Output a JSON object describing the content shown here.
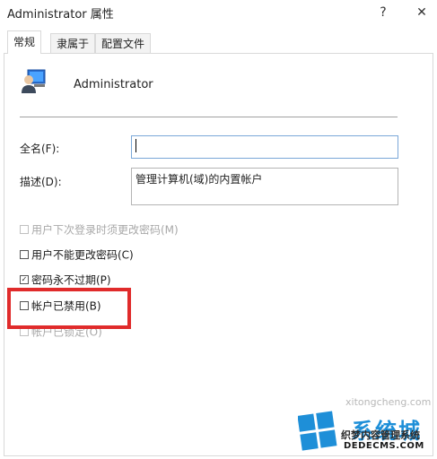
{
  "window": {
    "title": "Administrator 属性",
    "help_glyph": "?",
    "close_glyph": "✕"
  },
  "tabs": [
    {
      "label": "常规",
      "active": true
    },
    {
      "label": "隶属于",
      "active": false
    },
    {
      "label": "配置文件",
      "active": false
    }
  ],
  "general": {
    "username": "Administrator",
    "fullname": {
      "label": "全名(F):",
      "value": ""
    },
    "description": {
      "label": "描述(D):",
      "value": "管理计算机(域)的内置帐户"
    },
    "options": [
      {
        "label": "用户下次登录时须更改密码(M)",
        "checked": false,
        "disabled": true
      },
      {
        "label": "用户不能更改密码(C)",
        "checked": false,
        "disabled": false
      },
      {
        "label": "密码永不过期(P)",
        "checked": true,
        "disabled": false
      },
      {
        "label": "帐户已禁用(B)",
        "checked": false,
        "disabled": false
      },
      {
        "label": "帐户已锁定(O)",
        "checked": false,
        "disabled": true
      }
    ]
  },
  "watermark": {
    "brand": "系统城",
    "line1": "织梦内容管理系统",
    "line2": "DEDECMS.COM",
    "line3": "xitongcheng.com"
  }
}
